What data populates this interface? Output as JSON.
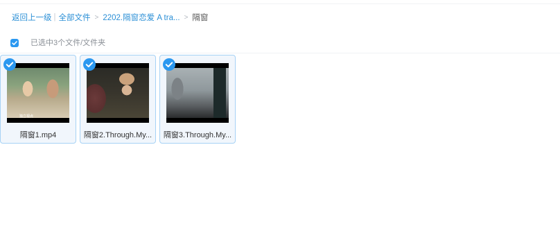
{
  "breadcrumb": {
    "back": "返回上一级",
    "all_files": "全部文件",
    "folder": "2202.隔窗恋爱 A tra...",
    "current": "隔窗",
    "separator": ">",
    "pipe": "|"
  },
  "selection": {
    "checked": true,
    "status": "已选中3个文件/文件夹"
  },
  "files": [
    {
      "name": "隔窗1.mp4",
      "selected": true,
      "thumb_caption": "独立视点"
    },
    {
      "name": "隔窗2.Through.My...",
      "selected": true
    },
    {
      "name": "隔窗3.Through.My...",
      "selected": true
    }
  ],
  "colors": {
    "accent": "#2b98f0",
    "link": "#2b8fd6",
    "tile_border": "#a6d2f5",
    "tile_bg": "#f1f6fc"
  }
}
